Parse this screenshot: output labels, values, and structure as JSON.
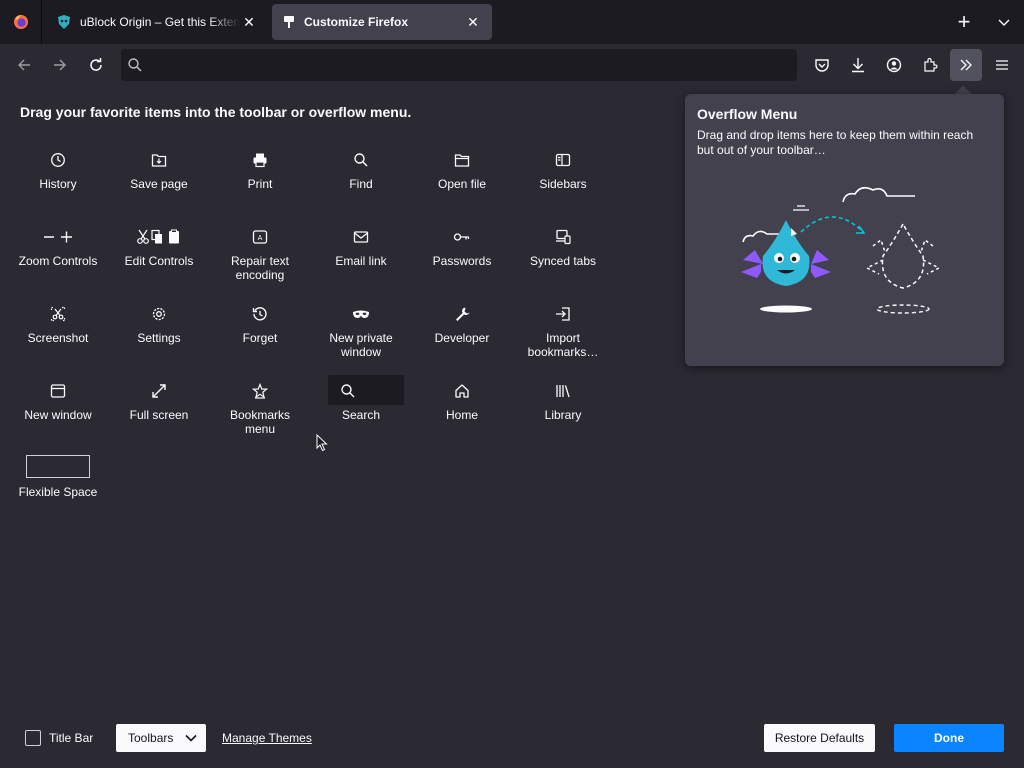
{
  "tabs": [
    {
      "title": "uBlock Origin – Get this Extension for Firefox",
      "icon": "ublock-icon",
      "close": "✕"
    },
    {
      "title": "Customize Firefox",
      "icon": "customize-icon",
      "close": "✕",
      "active": true
    }
  ],
  "tabstrip": {
    "new_tab_label": "+"
  },
  "navbar": {
    "back": "back-arrow-icon",
    "forward": "forward-arrow-icon",
    "reload": "reload-icon",
    "url_placeholder": "",
    "right_icons": [
      "pocket-icon",
      "downloads-icon",
      "account-icon",
      "extensions-icon",
      "overflow-chevrons-icon",
      "hamburger-menu-icon"
    ]
  },
  "heading": "Drag your favorite items into the toolbar or overflow menu.",
  "palette": [
    {
      "label": "History",
      "icon": "history-icon"
    },
    {
      "label": "Save page",
      "icon": "save-page-icon"
    },
    {
      "label": "Print",
      "icon": "print-icon"
    },
    {
      "label": "Find",
      "icon": "find-icon"
    },
    {
      "label": "Open file",
      "icon": "open-file-icon"
    },
    {
      "label": "Sidebars",
      "icon": "sidebars-icon"
    },
    {
      "label": "Zoom Controls",
      "icon": "zoom-controls-icon"
    },
    {
      "label": "Edit Controls",
      "icon": "edit-controls-icon"
    },
    {
      "label": "Repair text encoding",
      "icon": "repair-text-icon"
    },
    {
      "label": "Email link",
      "icon": "email-icon"
    },
    {
      "label": "Passwords",
      "icon": "key-icon"
    },
    {
      "label": "Synced tabs",
      "icon": "synced-tabs-icon"
    },
    {
      "label": "Screenshot",
      "icon": "screenshot-icon"
    },
    {
      "label": "Settings",
      "icon": "gear-icon"
    },
    {
      "label": "Forget",
      "icon": "forget-icon"
    },
    {
      "label": "New private window",
      "icon": "private-mask-icon"
    },
    {
      "label": "Developer",
      "icon": "wrench-icon"
    },
    {
      "label": "Import bookmarks…",
      "icon": "import-icon"
    },
    {
      "label": "New window",
      "icon": "new-window-icon"
    },
    {
      "label": "Full screen",
      "icon": "fullscreen-icon"
    },
    {
      "label": "Bookmarks menu",
      "icon": "bookmarks-star-icon"
    },
    {
      "label": "Search",
      "icon": "search-icon"
    },
    {
      "label": "Home",
      "icon": "home-icon"
    },
    {
      "label": "Library",
      "icon": "library-icon"
    }
  ],
  "flexible_space": "Flexible Space",
  "overflow_panel": {
    "title": "Overflow Menu",
    "description": "Drag and drop items here to keep them within reach but out of your toolbar…"
  },
  "bottom": {
    "title_bar_label": "Title Bar",
    "title_bar_checked": false,
    "toolbars_label": "Toolbars",
    "manage_themes": "Manage Themes",
    "restore_defaults": "Restore Defaults",
    "done": "Done"
  },
  "colors": {
    "background": "#2b2a33",
    "tabstrip": "#1c1b22",
    "accent_blue": "#0a84ff",
    "panel": "#42414d"
  }
}
